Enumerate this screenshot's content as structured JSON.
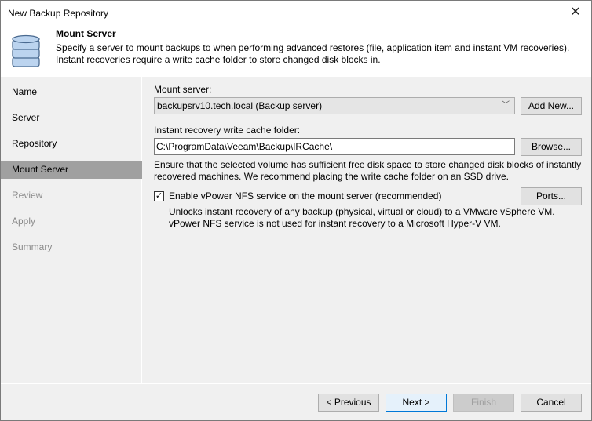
{
  "window": {
    "title": "New Backup Repository",
    "close_icon": "close-icon"
  },
  "header": {
    "title": "Mount Server",
    "description": "Specify a server to mount backups to when performing advanced restores (file, application item and instant VM recoveries). Instant recoveries require a write cache folder to store changed disk blocks in.",
    "icon": "database-icon"
  },
  "sidebar": {
    "items": [
      {
        "label": "Name"
      },
      {
        "label": "Server"
      },
      {
        "label": "Repository"
      },
      {
        "label": "Mount Server"
      },
      {
        "label": "Review"
      },
      {
        "label": "Apply"
      },
      {
        "label": "Summary"
      }
    ]
  },
  "main": {
    "mount_server_label": "Mount server:",
    "mount_server_value": "backupsrv10.tech.local (Backup server)",
    "add_new_label": "Add New...",
    "cache_folder_label": "Instant recovery write cache folder:",
    "cache_folder_value": "C:\\ProgramData\\Veeam\\Backup\\IRCache\\",
    "browse_label": "Browse...",
    "cache_note_1": "Ensure that the selected volume has sufficient free disk space to store changed disk blocks of instantly",
    "cache_note_2": "recovered machines. We recommend placing the write cache folder on an SSD drive.",
    "vpower_label": "Enable vPower NFS service on the mount server (recommended)",
    "vpower_checked": true,
    "ports_label": "Ports...",
    "vpower_note_1": "Unlocks instant recovery of any backup (physical, virtual or cloud) to a VMware vSphere VM.",
    "vpower_note_2": "vPower NFS service is not used for instant recovery to a Microsoft Hyper-V VM."
  },
  "footer": {
    "previous": "< Previous",
    "next": "Next >",
    "finish": "Finish",
    "cancel": "Cancel"
  }
}
